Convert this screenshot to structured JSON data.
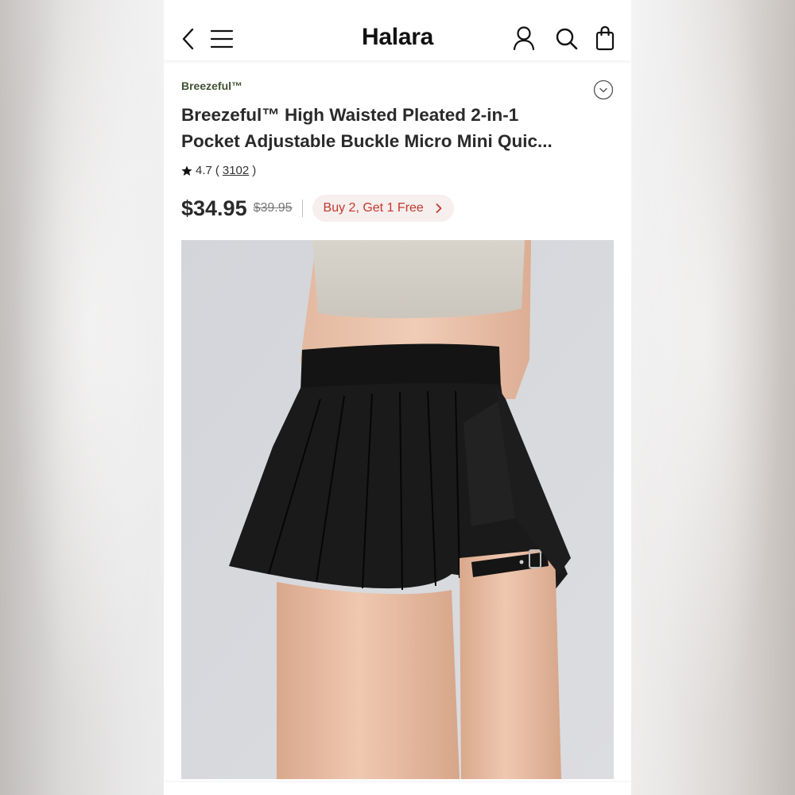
{
  "header": {
    "brand": "Halara",
    "icons": [
      "back-icon",
      "menu-icon",
      "user-icon",
      "search-icon",
      "bag-icon"
    ]
  },
  "product": {
    "brand_tag": "Breezeful™",
    "title_line1": "Breezeful™ High Waisted Pleated 2-in-1",
    "title_line2": "Pocket Adjustable Buckle Micro Mini Quic...",
    "rating": "4.7",
    "review_count": "3102",
    "price": "$34.95",
    "original_price": "$39.95",
    "promo_label": "Buy 2, Get 1 Free",
    "image_alt": "Black high waisted pleated mini skirt with adjustable buckle strap"
  },
  "colors": {
    "brand_tag": "#3f5234",
    "promo_text": "#c0392b",
    "promo_bg": "#f7eeee",
    "text_primary": "#2a2a2a"
  }
}
